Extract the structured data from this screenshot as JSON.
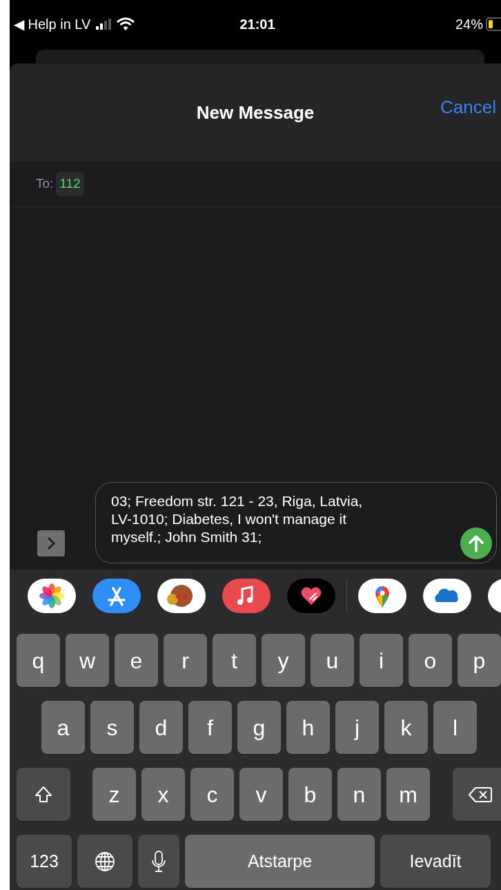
{
  "status_bar": {
    "back_label": "◀ Help in LV",
    "time": "21:01",
    "battery": "24%"
  },
  "header": {
    "title": "New Message",
    "cancel": "Cancel"
  },
  "recipient": {
    "label": "To:",
    "value": "112"
  },
  "compose": {
    "text": "03; Freedom str. 121 - 23, Riga, Latvia,\nLV-1010; Diabetes, I won't manage it\nmyself.; John Smith 31;"
  },
  "keyboard": {
    "rows": [
      {
        "keys": [
          {
            "kind": "letter",
            "label": "q"
          },
          {
            "kind": "letter",
            "label": "w"
          },
          {
            "kind": "letter",
            "label": "e"
          },
          {
            "kind": "letter",
            "label": "r"
          },
          {
            "kind": "letter",
            "label": "t"
          },
          {
            "kind": "letter",
            "label": "y"
          },
          {
            "kind": "letter",
            "label": "u"
          },
          {
            "kind": "letter",
            "label": "i"
          },
          {
            "kind": "letter",
            "label": "o"
          },
          {
            "kind": "letter",
            "label": "p"
          }
        ]
      },
      {
        "keys": [
          {
            "kind": "letter",
            "label": "a"
          },
          {
            "kind": "letter",
            "label": "s"
          },
          {
            "kind": "letter",
            "label": "d"
          },
          {
            "kind": "letter",
            "label": "f"
          },
          {
            "kind": "letter",
            "label": "g"
          },
          {
            "kind": "letter",
            "label": "h"
          },
          {
            "kind": "letter",
            "label": "j"
          },
          {
            "kind": "letter",
            "label": "k"
          },
          {
            "kind": "letter",
            "label": "l"
          }
        ]
      },
      {
        "keys": [
          {
            "kind": "shift"
          },
          {
            "kind": "letter",
            "label": "z"
          },
          {
            "kind": "letter",
            "label": "x"
          },
          {
            "kind": "letter",
            "label": "c"
          },
          {
            "kind": "letter",
            "label": "v"
          },
          {
            "kind": "letter",
            "label": "b"
          },
          {
            "kind": "letter",
            "label": "n"
          },
          {
            "kind": "letter",
            "label": "m"
          },
          {
            "kind": "backspace"
          }
        ]
      },
      {
        "keys": [
          {
            "kind": "numbers",
            "label": "123"
          },
          {
            "kind": "globe"
          },
          {
            "kind": "mic"
          },
          {
            "kind": "space",
            "label": "Atstarpe"
          },
          {
            "kind": "return",
            "label": "Ievadīt"
          }
        ]
      }
    ]
  }
}
